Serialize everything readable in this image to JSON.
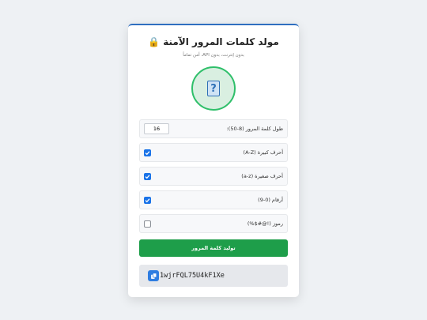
{
  "app": {
    "title": "مولد كلمات المرور الآمنة",
    "title_icon": "lock-icon",
    "subtitle": "بدون إنترنت، بدون API، أمن تماماً"
  },
  "strength": {
    "icon": "question-mark-icon",
    "colors": {
      "ring": "#2fbf6a",
      "fill": "#d9efe1"
    }
  },
  "length": {
    "label": "طول كلمة المرور (8-50):",
    "value": "16"
  },
  "options": [
    {
      "label": "أحرف كبيرة (A-Z)",
      "checked": true
    },
    {
      "label": "أحرف صغيرة (a-z)",
      "checked": true
    },
    {
      "label": "أرقام (0-9)",
      "checked": true
    },
    {
      "label": "رموز (!@#$%)",
      "checked": false
    }
  ],
  "generate_label": "توليد كلمة المرور",
  "output": {
    "password": "1wjrFQL75U4kF1Xe",
    "copy_icon": "copy-icon"
  },
  "colors": {
    "accent": "#1a73e8",
    "generate": "#1e9e4a",
    "top_border": "#2f6fc0"
  }
}
